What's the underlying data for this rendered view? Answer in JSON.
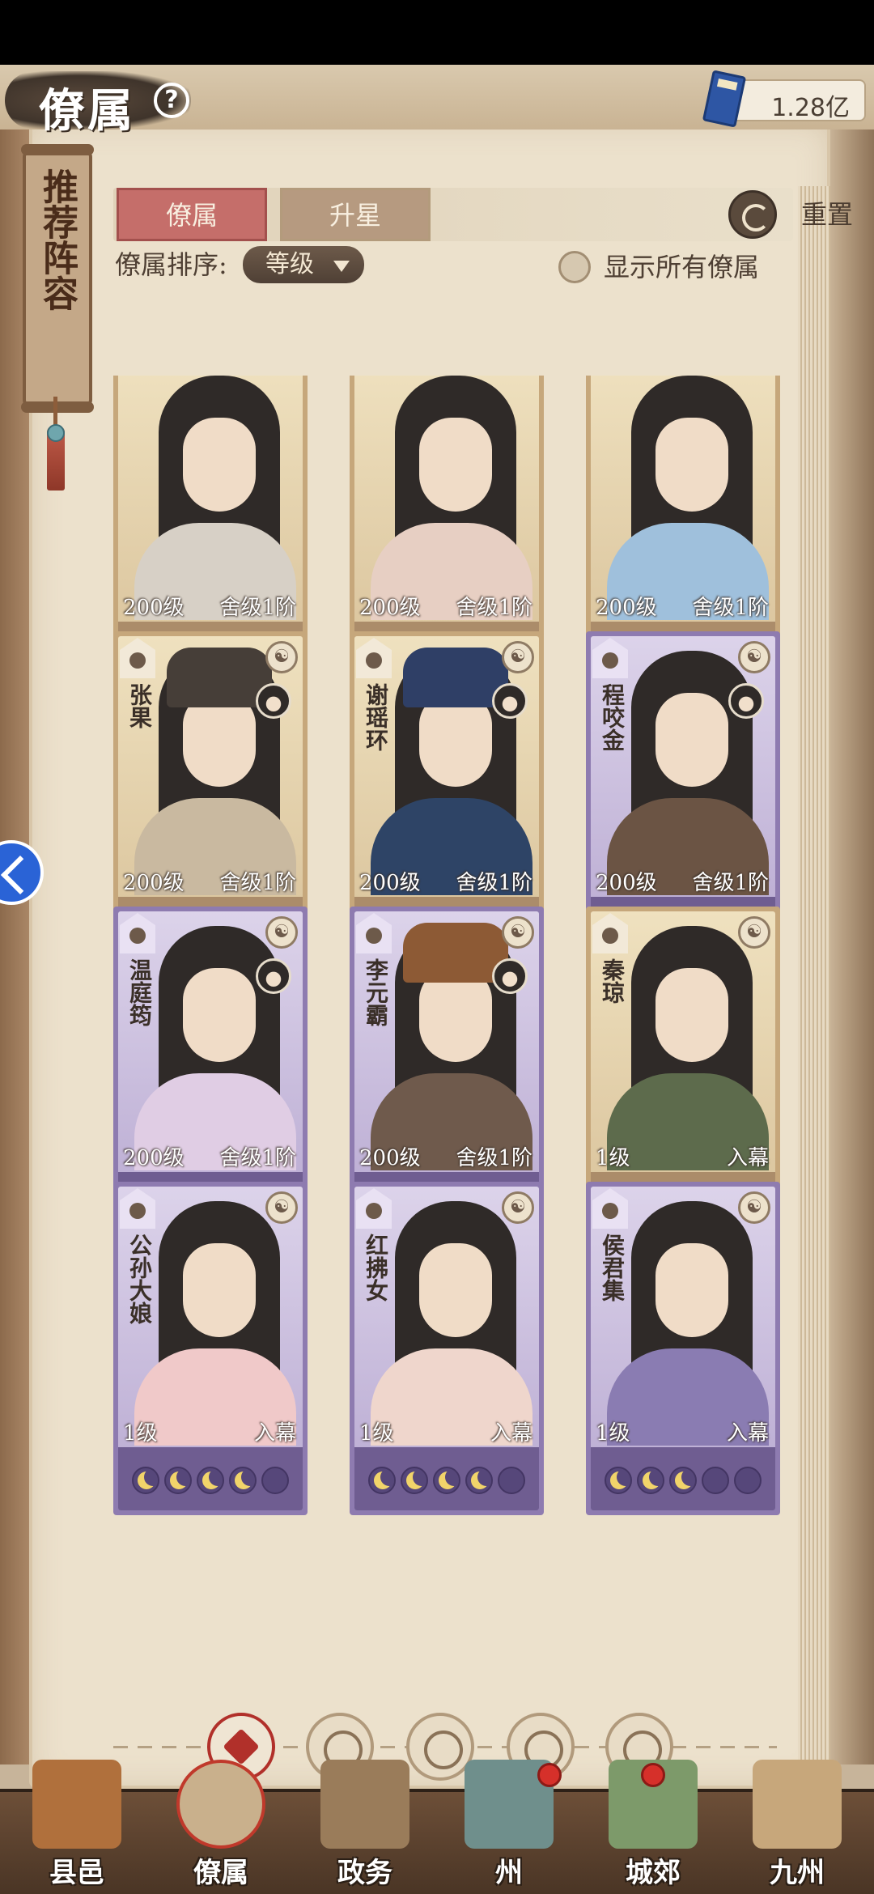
{
  "header": {
    "title": "僚属",
    "currency_value": "1.28亿"
  },
  "scroll_label": "推荐阵容",
  "tabs": [
    {
      "label": "僚属"
    },
    {
      "label": "升星"
    }
  ],
  "reset_label": "重置",
  "sort": {
    "label": "僚属排序:",
    "value": "等级"
  },
  "show_all_label": "显示所有僚属",
  "cards": [
    {
      "name": "",
      "level": "200级",
      "rank": "舍级1阶",
      "frame": "gold",
      "moons": [
        1,
        0,
        0,
        0,
        0
      ],
      "moon_style": "red",
      "body_color": "#d7d0c6"
    },
    {
      "name": "",
      "level": "200级",
      "rank": "舍级1阶",
      "frame": "gold",
      "moons": [
        1,
        1,
        1,
        1,
        0
      ],
      "body_color": "#e7cfc3"
    },
    {
      "name": "",
      "level": "200级",
      "rank": "舍级1阶",
      "frame": "gold",
      "moons": [
        1,
        1,
        0,
        0,
        0
      ],
      "body_color": "#9fc0dc"
    },
    {
      "name": "张果",
      "level": "200级",
      "rank": "舍级1阶",
      "frame": "gold",
      "moons": [
        1,
        1,
        1,
        1,
        1
      ],
      "body_color": "#c9b9a0",
      "hat": "#463e38"
    },
    {
      "name": "谢瑶环",
      "level": "200级",
      "rank": "舍级1阶",
      "frame": "gold",
      "moons": [
        1,
        1,
        1,
        0,
        0
      ],
      "body_color": "#2e4466",
      "hat": "#2f3f66"
    },
    {
      "name": "程咬金",
      "level": "200级",
      "rank": "舍级1阶",
      "frame": "purple",
      "moons": [
        1,
        1,
        0,
        0,
        0
      ],
      "body_color": "#6b5444"
    },
    {
      "name": "温庭筠",
      "level": "200级",
      "rank": "舍级1阶",
      "frame": "purple",
      "moons": [
        1,
        1,
        0,
        0,
        0
      ],
      "body_color": "#e0cde4"
    },
    {
      "name": "李元霸",
      "level": "200级",
      "rank": "舍级1阶",
      "frame": "purple",
      "moons": [
        1,
        1,
        1,
        0,
        0
      ],
      "body_color": "#6f5a4c",
      "hat": "#8d5a35"
    },
    {
      "name": "秦琼",
      "level": "1级",
      "rank": "入幕",
      "frame": "gold",
      "moons": [
        1,
        1,
        0,
        0,
        0
      ],
      "body_color": "#5d6b4c"
    },
    {
      "name": "公孙大娘",
      "level": "1级",
      "rank": "入幕",
      "frame": "purple",
      "moons": [
        1,
        1,
        1,
        1,
        0
      ],
      "body_color": "#f0c9c9"
    },
    {
      "name": "红拂女",
      "level": "1级",
      "rank": "入幕",
      "frame": "purple",
      "moons": [
        1,
        1,
        1,
        1,
        0
      ],
      "body_color": "#efd6cc"
    },
    {
      "name": "侯君集",
      "level": "1级",
      "rank": "入幕",
      "frame": "purple",
      "moons": [
        1,
        1,
        1,
        0,
        0
      ],
      "body_color": "#8a7cb2"
    }
  ],
  "filters": [
    "all",
    "wisdom",
    "politics",
    "charm",
    "strength"
  ],
  "bottom_nav": [
    {
      "label": "县邑",
      "color": "#b0703c"
    },
    {
      "label": "僚属",
      "color": "#c9b08c"
    },
    {
      "label": "政务",
      "color": "#9a7c5a"
    },
    {
      "label": "州",
      "color": "#6f8f8c"
    },
    {
      "label": "城郊",
      "color": "#7d9a6a"
    },
    {
      "label": "九州",
      "color": "#c7a77b"
    }
  ],
  "colors": {
    "accent_red": "#c56e6a",
    "gold_frame": "#c6a77b",
    "purple_frame": "#8e7bb0"
  }
}
